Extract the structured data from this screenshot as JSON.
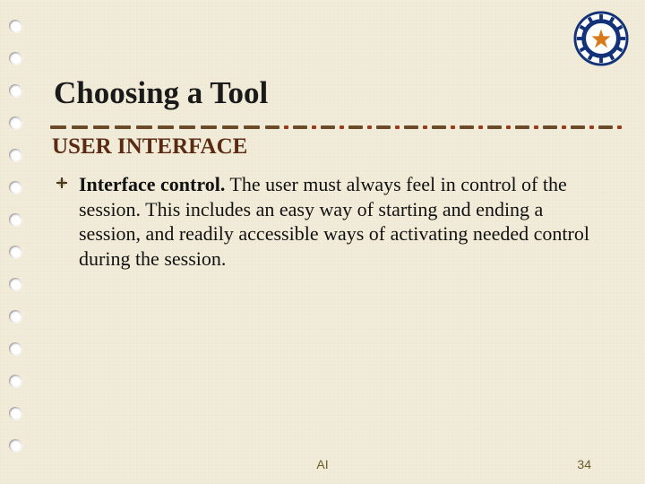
{
  "title": "Choosing a Tool",
  "subtitle": "USER INTERFACE",
  "bullet": {
    "lead": "Interface control.",
    "text": " The user must always feel in control of the session. This includes an easy way of starting and ending a session, and readily accessible ways of activating needed control during the session."
  },
  "footer": {
    "center": "AI",
    "page": "34"
  },
  "colors": {
    "accent": "#5a2a12",
    "divider_dark": "#6b4a2a",
    "divider_red": "#9a3b1b"
  }
}
